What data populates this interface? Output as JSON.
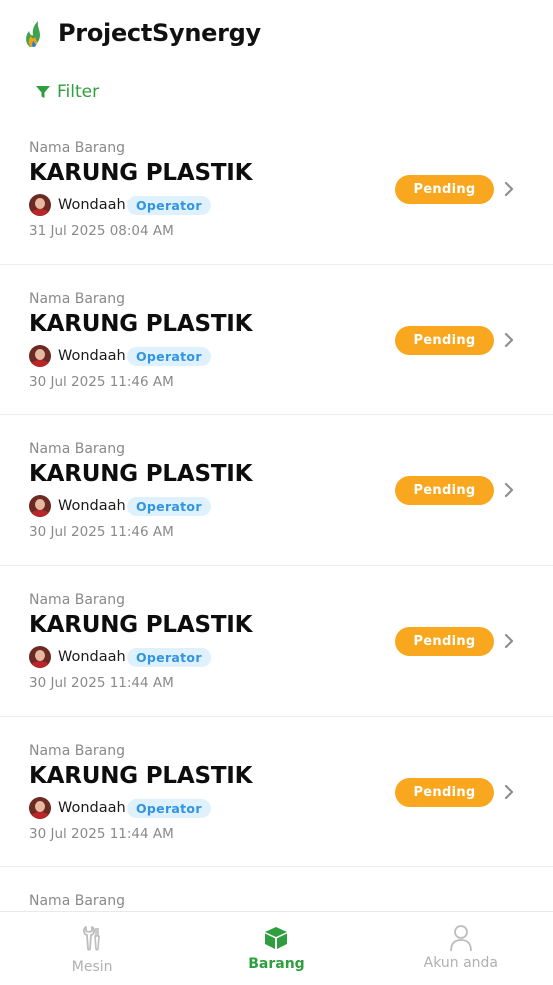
{
  "app": {
    "title": "ProjectSynergy"
  },
  "filter": {
    "label": "Filter"
  },
  "items": [
    {
      "label": "Nama Barang",
      "title": "KARUNG PLASTIK",
      "user": "Wondaah",
      "role": "Operator",
      "timestamp": "31 Jul 2025 08:04 AM",
      "status": "Pending"
    },
    {
      "label": "Nama Barang",
      "title": "KARUNG PLASTIK",
      "user": "Wondaah",
      "role": "Operator",
      "timestamp": "30 Jul 2025 11:46 AM",
      "status": "Pending"
    },
    {
      "label": "Nama Barang",
      "title": "KARUNG PLASTIK",
      "user": "Wondaah",
      "role": "Operator",
      "timestamp": "30 Jul 2025 11:46 AM",
      "status": "Pending"
    },
    {
      "label": "Nama Barang",
      "title": "KARUNG PLASTIK",
      "user": "Wondaah",
      "role": "Operator",
      "timestamp": "30 Jul 2025 11:44 AM",
      "status": "Pending"
    },
    {
      "label": "Nama Barang",
      "title": "KARUNG PLASTIK",
      "user": "Wondaah",
      "role": "Operator",
      "timestamp": "30 Jul 2025 11:44 AM",
      "status": "Pending"
    },
    {
      "label": "Nama Barang"
    }
  ],
  "nav": [
    {
      "label": "Mesin",
      "icon": "wrench-icon",
      "active": false
    },
    {
      "label": "Barang",
      "icon": "box-icon",
      "active": true
    },
    {
      "label": "Akun anda",
      "icon": "user-icon",
      "active": false
    }
  ],
  "colors": {
    "accent": "#2e9e3e",
    "pending": "#f8a71f",
    "role_bg": "#dff1fd",
    "role_text": "#2f95e3"
  }
}
